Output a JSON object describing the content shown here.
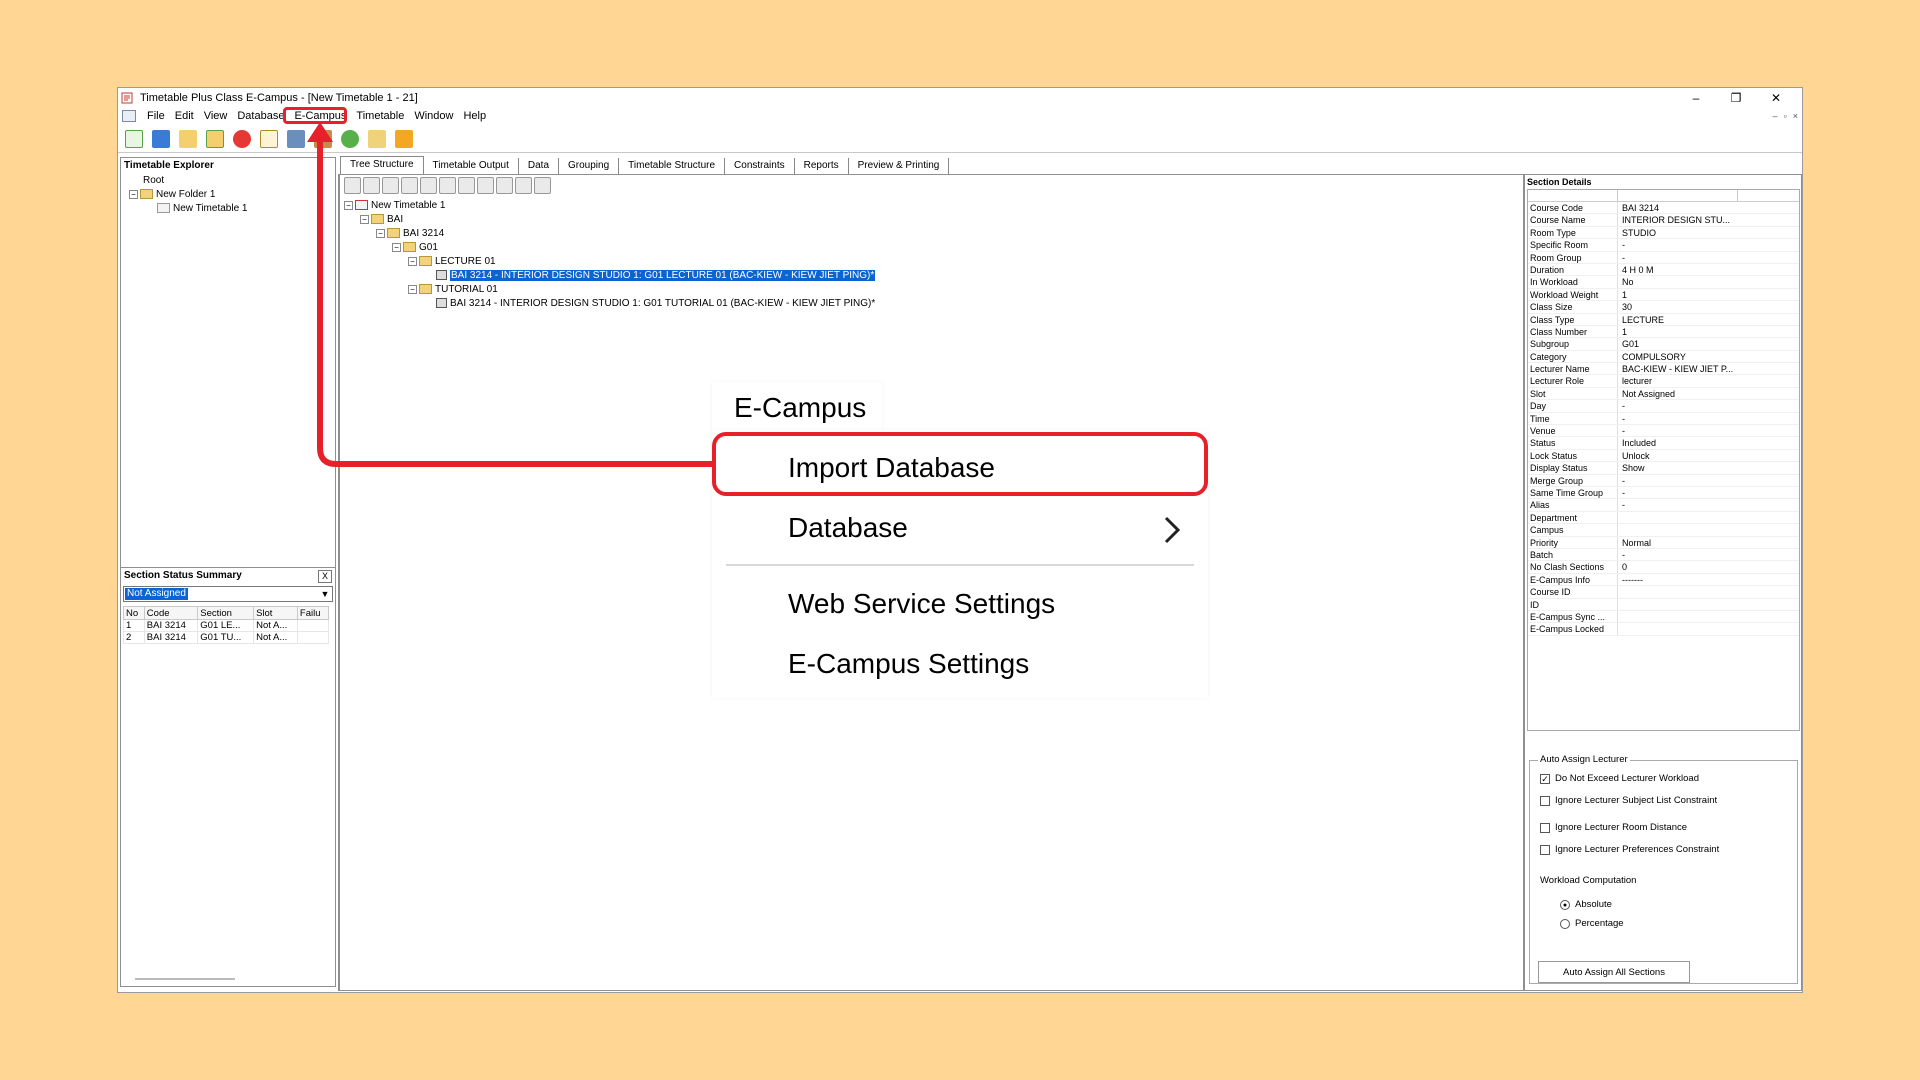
{
  "window": {
    "title": "Timetable Plus Class E-Campus - [New Timetable 1 - 21]",
    "controls": [
      "–",
      "❐",
      "✕"
    ]
  },
  "menubar": {
    "items": [
      "File",
      "Edit",
      "View",
      "Database",
      "E-Campus",
      "Timetable",
      "Window",
      "Help"
    ],
    "mdi_controls": [
      "–",
      "▫",
      "×"
    ]
  },
  "explorer": {
    "title": "Timetable Explorer",
    "tree": [
      "Root",
      "New Folder 1",
      "New Timetable 1"
    ]
  },
  "status_summary": {
    "title": "Section Status Summary",
    "close": "X",
    "filter": "Not Assigned",
    "columns": [
      "No",
      "Code",
      "Section",
      "Slot",
      "Failu"
    ],
    "rows": [
      [
        "1",
        "BAI 3214",
        "G01 LE...",
        "Not A...",
        ""
      ],
      [
        "2",
        "BAI 3214",
        "G01 TU...",
        "Not A...",
        ""
      ]
    ]
  },
  "tabs": [
    "Tree Structure",
    "Timetable Output",
    "Data",
    "Grouping",
    "Timetable Structure",
    "Constraints",
    "Reports",
    "Preview & Printing"
  ],
  "tree": {
    "root": "New Timetable 1",
    "bai": "BAI",
    "course": "BAI 3214",
    "group": "G01",
    "lecture": "LECTURE 01",
    "lecture_item": "BAI 3214 - INTERIOR DESIGN STUDIO 1: G01 LECTURE 01 (BAC-KIEW - KIEW JIET PING)*",
    "tutorial": "TUTORIAL 01",
    "tutorial_item": "BAI 3214 - INTERIOR DESIGN STUDIO 1: G01 TUTORIAL 01 (BAC-KIEW - KIEW JIET PING)*"
  },
  "section_details": {
    "title": "Section Details",
    "rows": [
      [
        "Course Code",
        "BAI 3214"
      ],
      [
        "Course Name",
        "INTERIOR DESIGN STU..."
      ],
      [
        "Room Type",
        "STUDIO"
      ],
      [
        "Specific Room",
        "-"
      ],
      [
        "Room Group",
        "-"
      ],
      [
        "Duration",
        "4 H 0 M"
      ],
      [
        "In Workload",
        "No"
      ],
      [
        "Workload Weight",
        "1"
      ],
      [
        "Class Size",
        "30"
      ],
      [
        "Class Type",
        "LECTURE"
      ],
      [
        "Class Number",
        "1"
      ],
      [
        "Subgroup",
        "G01"
      ],
      [
        "Category",
        "COMPULSORY"
      ],
      [
        "Lecturer Name",
        "BAC-KIEW - KIEW JIET P..."
      ],
      [
        "Lecturer Role",
        "lecturer"
      ],
      [
        "Slot",
        "Not Assigned"
      ],
      [
        "Day",
        "-"
      ],
      [
        "Time",
        "-"
      ],
      [
        "Venue",
        "-"
      ],
      [
        "Status",
        "Included"
      ],
      [
        "Lock Status",
        "Unlock"
      ],
      [
        "Display Status",
        "Show"
      ],
      [
        "Merge Group",
        "-"
      ],
      [
        "Same Time Group",
        "-"
      ],
      [
        "Alias",
        "-"
      ],
      [
        "Department",
        ""
      ],
      [
        "Campus",
        ""
      ],
      [
        "Priority",
        "Normal"
      ],
      [
        "Batch",
        "-"
      ],
      [
        "No Clash Sections",
        "0"
      ],
      [
        "E-Campus Info",
        "-------"
      ],
      [
        "Course ID",
        ""
      ],
      [
        "ID",
        ""
      ],
      [
        "E-Campus Sync ...",
        ""
      ],
      [
        "E-Campus Locked",
        ""
      ]
    ]
  },
  "auto_assign": {
    "title": "Auto Assign Lecturer",
    "options": [
      {
        "label": "Do Not Exceed Lecturer Workload",
        "checked": true
      },
      {
        "label": "Ignore Lecturer Subject List Constraint",
        "checked": false
      },
      {
        "label": "Ignore Lecturer Room Distance",
        "checked": false
      },
      {
        "label": "Ignore Lecturer Preferences Constraint",
        "checked": false
      }
    ],
    "workload_label": "Workload Computation",
    "radio": [
      {
        "label": "Absolute",
        "checked": true
      },
      {
        "label": "Percentage",
        "checked": false
      }
    ],
    "button": "Auto Assign All Sections"
  },
  "callout": {
    "header": "E-Campus",
    "items": [
      "Import Database",
      "Database",
      "Web Service Settings",
      "E-Campus Settings"
    ],
    "highlight_color": "#e8202a"
  },
  "colors": {
    "background": "#FFD694",
    "selection": "#0a64d2",
    "highlight": "#e8202a"
  }
}
